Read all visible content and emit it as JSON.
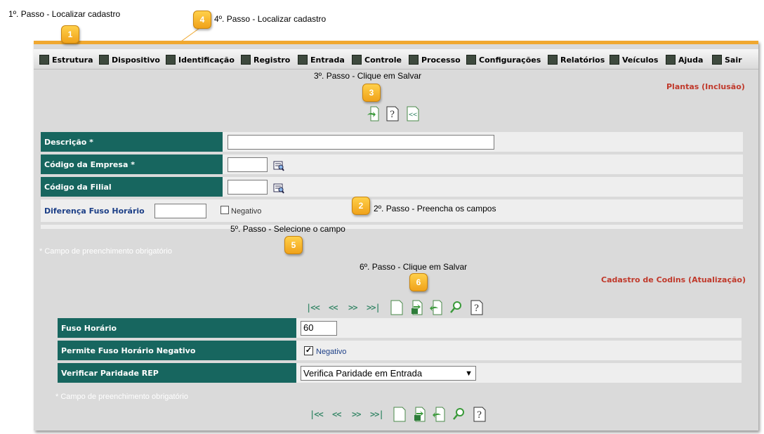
{
  "steps": {
    "step1": "1º. Passo - Localizar cadastro",
    "step2": "2º. Passo - Preencha os campos",
    "step3": "3º. Passo - Clique em Salvar",
    "step4": "4º. Passo - Localizar cadastro",
    "step5": "5º. Passo - Selecione o campo",
    "step6": "6º. Passo - Clique em Salvar"
  },
  "badges": [
    "1",
    "2",
    "3",
    "4",
    "5",
    "6"
  ],
  "menu": [
    "Estrutura",
    "Dispositivo",
    "Identificação",
    "Registro",
    "Entrada",
    "Controle",
    "Processo",
    "Configurações",
    "Relatórios",
    "Veículos",
    "Ajuda",
    "Sair"
  ],
  "form1": {
    "title": "Plantas (Inclusão)",
    "descricao_label": "Descrição *",
    "descricao_value": "",
    "empresa_label": "Código da Empresa *",
    "empresa_value": "",
    "filial_label": "Código da Filial",
    "filial_value": "",
    "fuso_label": "Diferença Fuso Horário",
    "fuso_value": "",
    "negativo_label": "Negativo",
    "required_note": "* Campo de preenchimento obrigatório"
  },
  "form2": {
    "title": "Cadastro de Codins (Atualização)",
    "nav_first": "|<<",
    "nav_prev": "<<",
    "nav_next": ">>",
    "nav_last": ">>|",
    "fuso_label": "Fuso Horário",
    "fuso_value": "60",
    "permite_label": "Permite Fuso Horário Negativo",
    "negativo_label": "Negativo",
    "negativo_checked": true,
    "paridade_label": "Verificar Paridade REP",
    "paridade_value": "Verifica Paridade em Entrada",
    "required_note": "* Campo de preenchimento obrigatório"
  },
  "colors": {
    "accent_orange": "#f0a830",
    "label_teal": "#17665f",
    "title_red": "#c0392b",
    "panel_gray": "#dadada"
  }
}
